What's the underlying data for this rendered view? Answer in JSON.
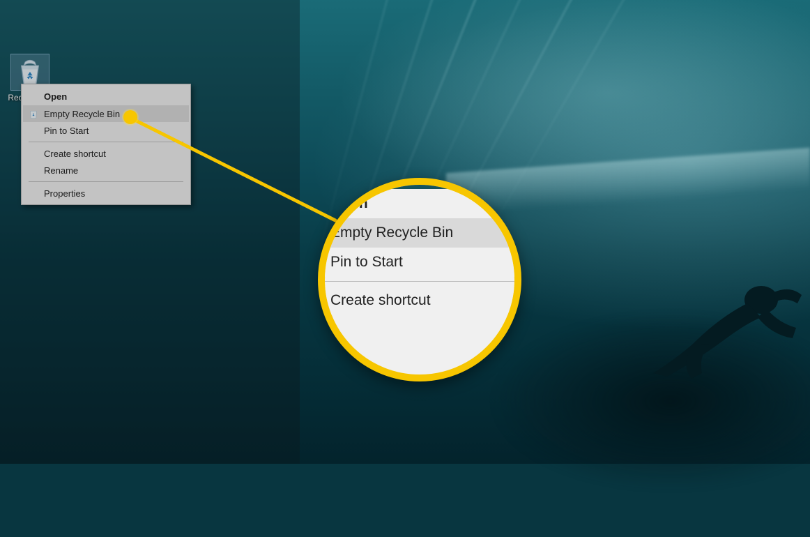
{
  "desktop": {
    "icon_label": "Recycle Bin"
  },
  "context_menu": {
    "items": [
      {
        "label": "Open",
        "bold": true,
        "hover": false,
        "icon": null
      },
      {
        "label": "Empty Recycle Bin",
        "bold": false,
        "hover": true,
        "icon": "recycle-bin-icon"
      },
      {
        "label": "Pin to Start",
        "bold": false,
        "hover": false,
        "icon": null
      }
    ],
    "items2": [
      {
        "label": "Create shortcut",
        "bold": false,
        "hover": false,
        "icon": null
      },
      {
        "label": "Rename",
        "bold": false,
        "hover": false,
        "icon": null
      }
    ],
    "items3": [
      {
        "label": "Properties",
        "bold": false,
        "hover": false,
        "icon": null
      }
    ]
  },
  "magnifier": {
    "rows": [
      {
        "label": "Open",
        "bold": true,
        "hover": false,
        "icon": null
      },
      {
        "label": "Empty Recycle Bin",
        "bold": false,
        "hover": true,
        "icon": "recycle-bin-icon"
      },
      {
        "label": "Pin to Start",
        "bold": false,
        "hover": false,
        "icon": null
      }
    ],
    "tail": {
      "label": "Create shortcut"
    }
  },
  "callout": {
    "accent_color": "#f7c600"
  }
}
